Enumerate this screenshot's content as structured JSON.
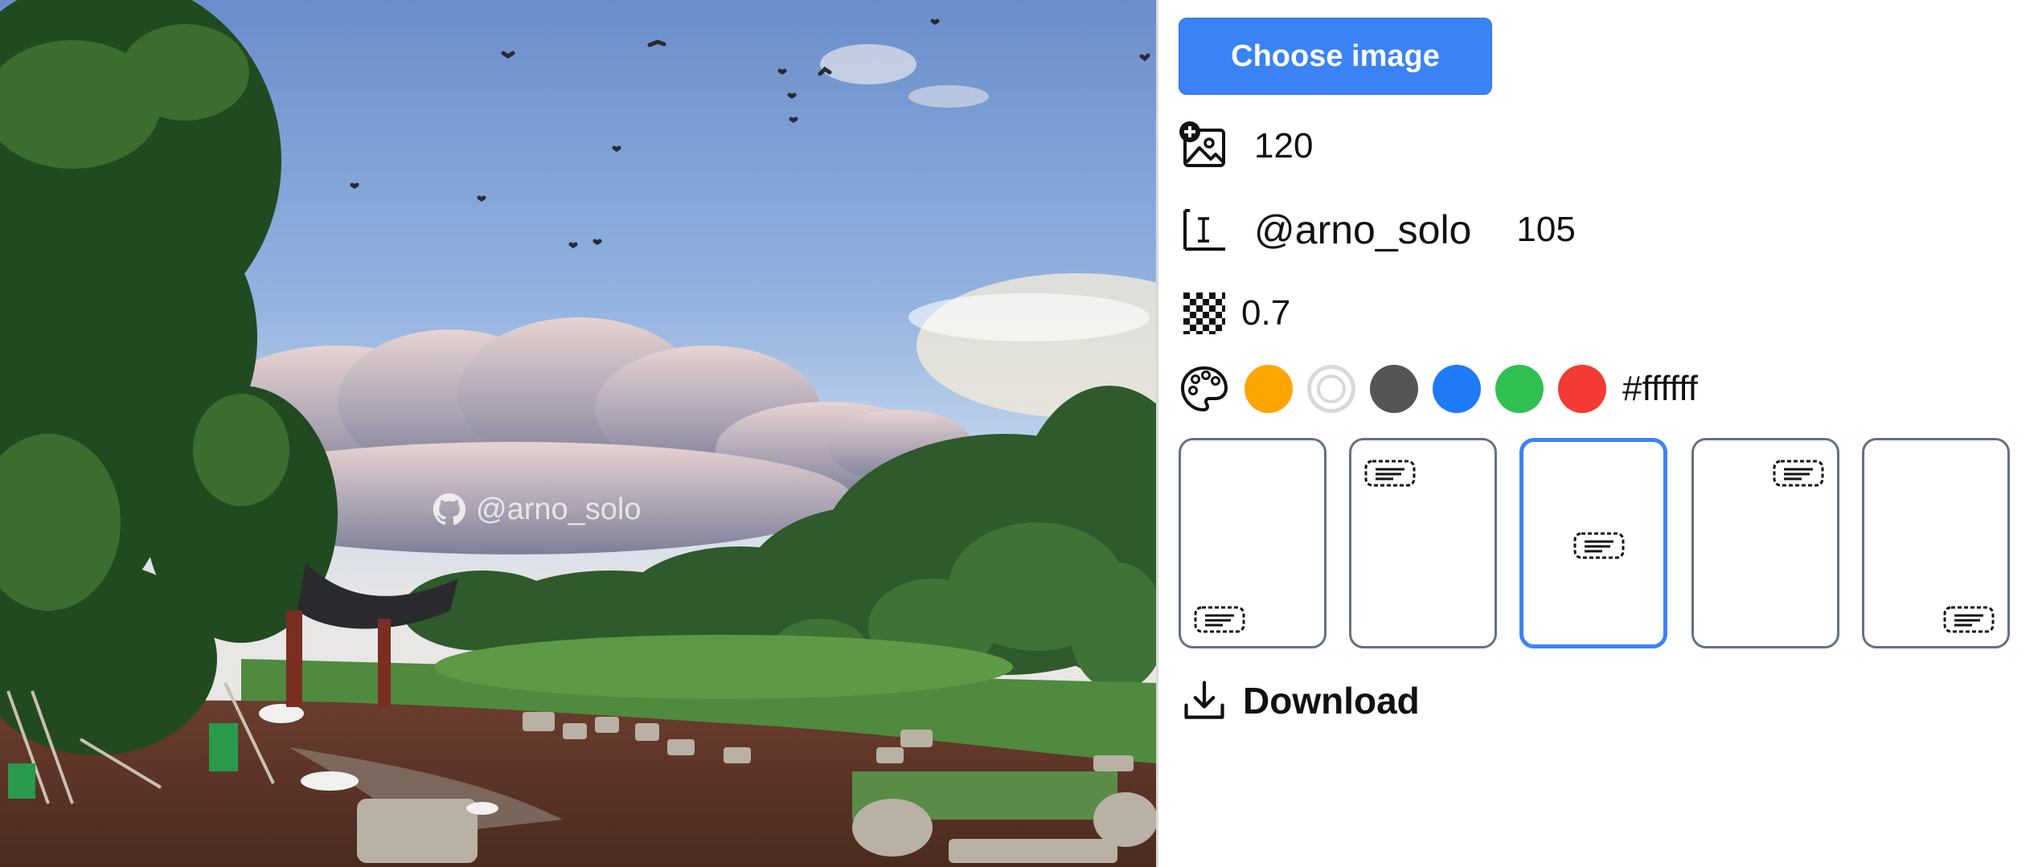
{
  "photo": {
    "watermark_text": "@arno_solo"
  },
  "controls": {
    "choose_button_label": "Choose image",
    "image_size_value": "120",
    "watermark_text": "@arno_solo",
    "text_size_value": "105",
    "opacity_value": "0.7",
    "colors": [
      "#ffa500",
      "#ffffff",
      "#555555",
      "#1f7af5",
      "#2fc051",
      "#f33a33"
    ],
    "selected_color_hex": "#ffffff",
    "positions": [
      "bottom-left",
      "top-left",
      "center",
      "top-right",
      "bottom-right"
    ],
    "selected_position": "center",
    "download_label": "Download"
  },
  "icons": {
    "image_size": "add-image-icon",
    "text_size": "text-cursor-icon",
    "opacity": "checkerboard-icon",
    "color": "palette-icon",
    "download": "download-icon",
    "watermark": "github-icon"
  }
}
